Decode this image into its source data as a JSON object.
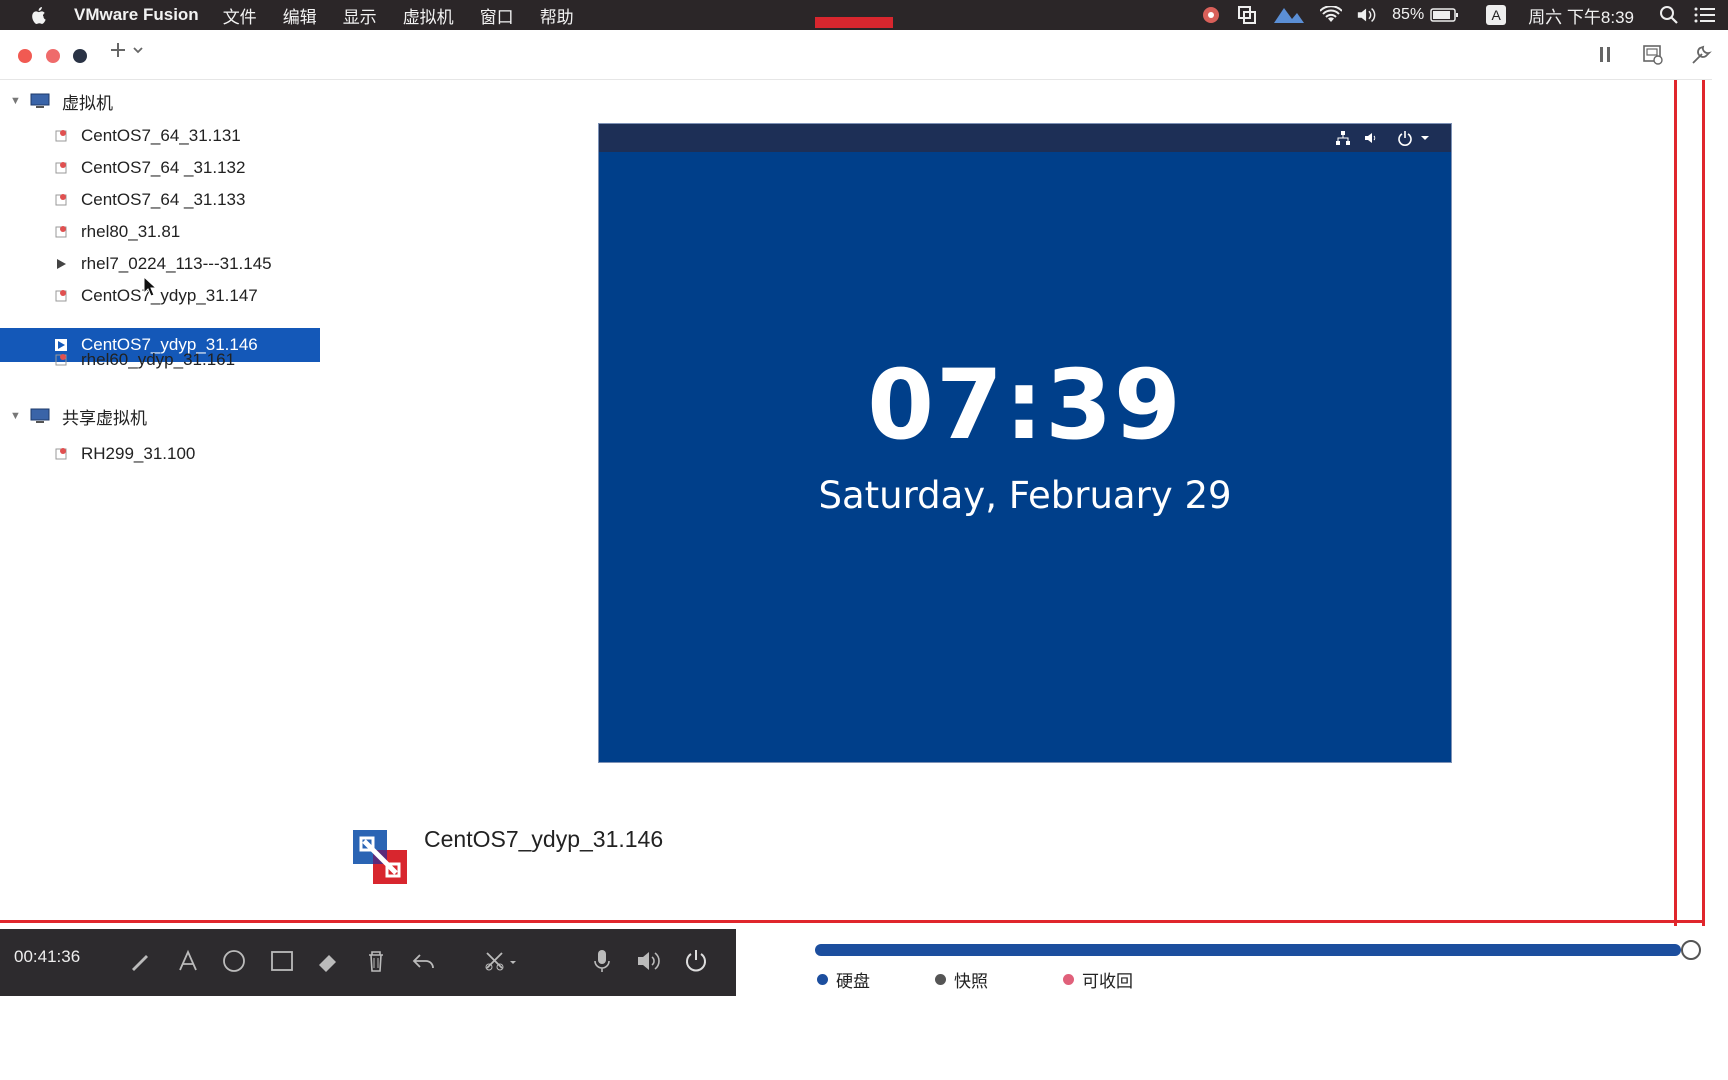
{
  "menubar": {
    "app_name": "VMware Fusion",
    "menus": [
      "文件",
      "编辑",
      "显示",
      "虚拟机",
      "窗口",
      "帮助"
    ],
    "battery": "85%",
    "ime": "A",
    "clock": "周六 下午8:39"
  },
  "sidebar": {
    "groups": [
      {
        "label": "虚拟机",
        "items": [
          {
            "label": "CentOS7_64_31.131"
          },
          {
            "label": "CentOS7_64 _31.132"
          },
          {
            "label": "CentOS7_64 _31.133"
          },
          {
            "label": "rhel80_31.81"
          },
          {
            "label": "rhel7_0224_113---31.145"
          },
          {
            "label": "CentOS7_ydyp_31.147"
          },
          {
            "label": "CentOS7_ydyp_31.146",
            "selected": true
          },
          {
            "label": "rhel60_ydyp_31.161"
          }
        ]
      },
      {
        "label": "共享虚拟机",
        "items": [
          {
            "label": "RH299_31.100"
          }
        ]
      }
    ]
  },
  "console": {
    "time": "07:39",
    "date": "Saturday, February 29"
  },
  "vm_info": {
    "name": "CentOS7_ydyp_31.146"
  },
  "recorder": {
    "elapsed": "00:41:36"
  },
  "storage": {
    "legend": [
      {
        "label": "硬盘",
        "color": "#1c4e9e"
      },
      {
        "label": "快照",
        "color": "#555555"
      },
      {
        "label": "可收回",
        "color": "#e0607a"
      }
    ]
  },
  "colors": {
    "selection": "#1458b8",
    "console_bg": "#003f8a",
    "recording_frame": "#e0262c"
  }
}
